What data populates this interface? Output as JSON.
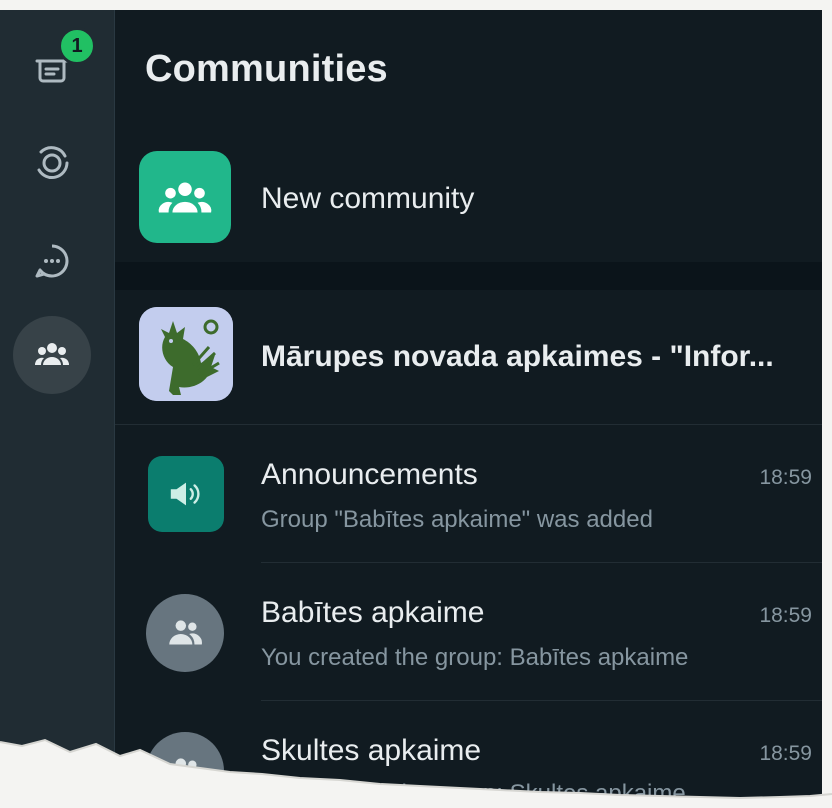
{
  "rail": {
    "chats_badge": "1",
    "active_item": "communities"
  },
  "header": {
    "title": "Communities"
  },
  "new_community": {
    "label": "New community",
    "icon": "community-icon",
    "color": "#21b78b"
  },
  "community": {
    "name": "Mārupes novada apkaimes - \"Infor...",
    "chats": [
      {
        "title": "Announcements",
        "subtitle": "Group \"Babītes apkaime\" was added",
        "time": "18:59",
        "icon": "megaphone-icon"
      },
      {
        "title": "Babītes apkaime",
        "subtitle": "You created the group: Babītes apkaime",
        "time": "18:59",
        "icon": "group-icon"
      },
      {
        "title": "Skultes apkaime",
        "subtitle": "You created the group: Skultes apkaime",
        "time": "18:59",
        "icon": "group-icon"
      }
    ]
  },
  "colors": {
    "background": "#111b21",
    "rail": "#202c33",
    "accent": "#21c063",
    "text_primary": "#e9edef",
    "text_secondary": "#8696a0"
  }
}
